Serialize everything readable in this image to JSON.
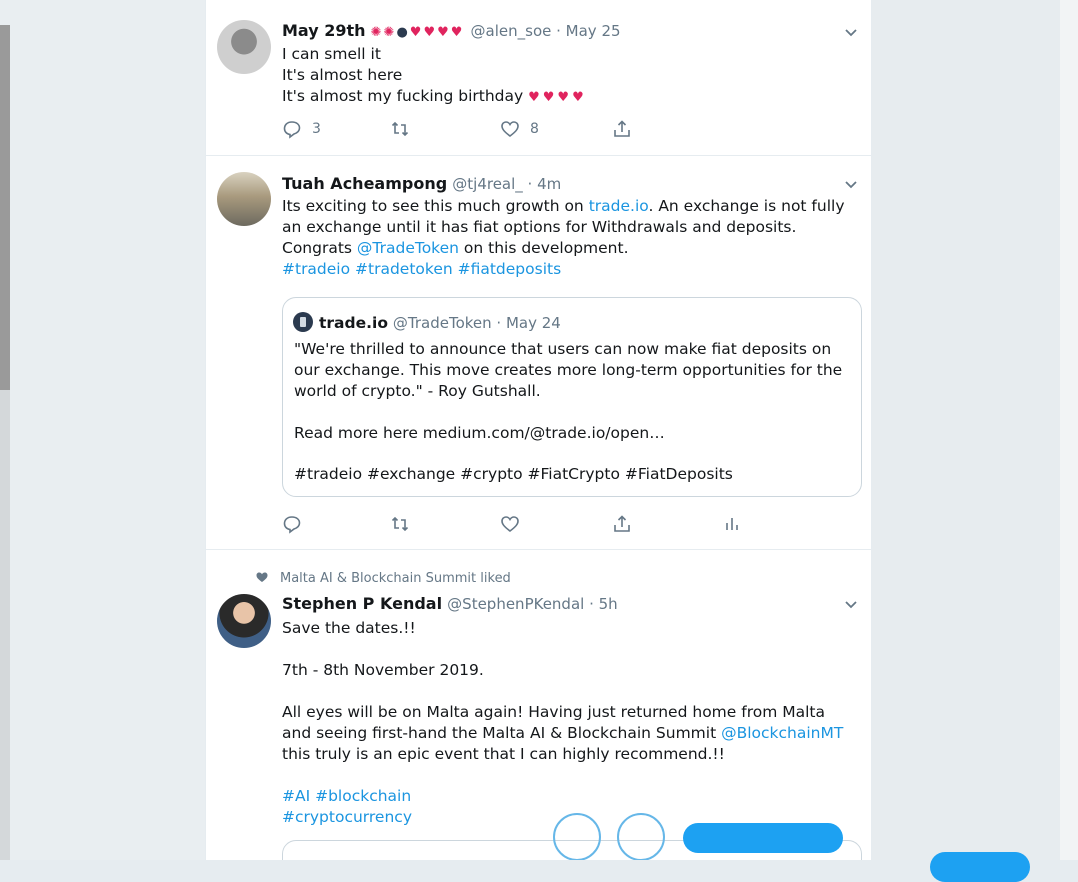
{
  "tweets": [
    {
      "name": "May 29th",
      "handle_line": "@alen_soe · May 25",
      "lines": [
        "I can smell it",
        "It's almost here",
        "It's almost my fucking birthday"
      ],
      "actions": {
        "reply_count": "3",
        "like_count": "8"
      }
    },
    {
      "name": "Tuah Acheampong",
      "handle_line": "@tj4real_ · 4m",
      "text_a": "Its exciting to see this much growth on ",
      "link_1": "trade.io",
      "text_b": ". An exchange is not fully an exchange until it has fiat options for Withdrawals and deposits. Congrats ",
      "link_2": "@TradeToken",
      "text_c": "  on this development.",
      "hashtags": "#tradeio #tradetoken #fiatdeposits",
      "quote": {
        "name": "trade.io",
        "handle_line": "@TradeToken · May 24",
        "text": "\"We're thrilled to announce that users can now make fiat deposits on our exchange. This move creates more long-term opportunities for the world of crypto.\" - Roy Gutshall.",
        "read_more": "Read more here medium.com/@trade.io/open…",
        "tags": "#tradeio #exchange #crypto #FiatCrypto #FiatDeposits"
      }
    },
    {
      "liked_by": "Malta AI & Blockchain Summit liked",
      "name": "Stephen P Kendal",
      "handle_line": "@StephenPKendal · 5h",
      "line1": "Save the dates.!!",
      "line2": "7th - 8th November 2019.",
      "para_a": "All eyes will be on Malta again! Having just returned home from Malta and seeing first-hand the Malta AI & Blockchain Summit ",
      "para_link": "@BlockchainMT",
      "para_b": " this truly is an epic event that I can highly recommend.!!",
      "tags1": "#AI #blockchain",
      "tags2": "#cryptocurrency"
    }
  ],
  "colors": {
    "link": "#1b95e0",
    "muted": "#657786",
    "accent": "#1da1f2"
  },
  "icons": [
    "reply-icon",
    "retweet-icon",
    "like-icon",
    "share-icon",
    "analytics-icon",
    "chevron-down-icon",
    "heart-icon"
  ]
}
